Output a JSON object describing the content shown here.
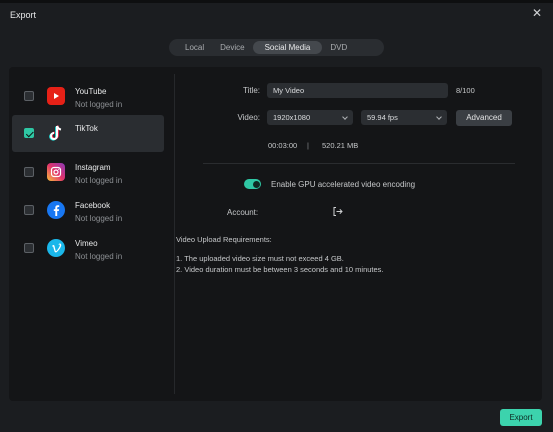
{
  "window": {
    "title": "Export"
  },
  "tabs": [
    {
      "label": "Local"
    },
    {
      "label": "Device"
    },
    {
      "label": "Social Media"
    },
    {
      "label": "DVD"
    }
  ],
  "active_tab": "Social Media",
  "platforms": [
    {
      "name": "YouTube",
      "status": "Not logged in",
      "checked": false,
      "icon": "youtube-icon",
      "color": "#e62117"
    },
    {
      "name": "TikTok",
      "status": "",
      "checked": true,
      "icon": "tiktok-icon",
      "color": "#000000"
    },
    {
      "name": "Instagram",
      "status": "Not logged in",
      "checked": false,
      "icon": "instagram-icon",
      "color": "#d6249f"
    },
    {
      "name": "Facebook",
      "status": "Not logged in",
      "checked": false,
      "icon": "facebook-icon",
      "color": "#1877f2"
    },
    {
      "name": "Vimeo",
      "status": "Not logged in",
      "checked": false,
      "icon": "vimeo-icon",
      "color": "#1ab7ea"
    }
  ],
  "form": {
    "title_label": "Title:",
    "title_value": "My Video",
    "title_counter": "8/100",
    "video_label": "Video:",
    "resolution": "1920x1080",
    "fps": "59.94 fps",
    "advanced_label": "Advanced",
    "duration": "00:03:00",
    "separator": "|",
    "size": "520.21 MB",
    "gpu_label": "Enable GPU accelerated video encoding",
    "gpu_enabled": true,
    "account_label": "Account:"
  },
  "requirements": {
    "heading": "Video Upload Requirements:",
    "items": [
      "1. The uploaded video size must not exceed 4 GB.",
      "2. Video duration must be between 3 seconds and 10 minutes."
    ]
  },
  "footer": {
    "export_label": "Export"
  },
  "colors": {
    "accent": "#3cd3ad",
    "panel": "#141517",
    "window": "#1b1d20"
  }
}
